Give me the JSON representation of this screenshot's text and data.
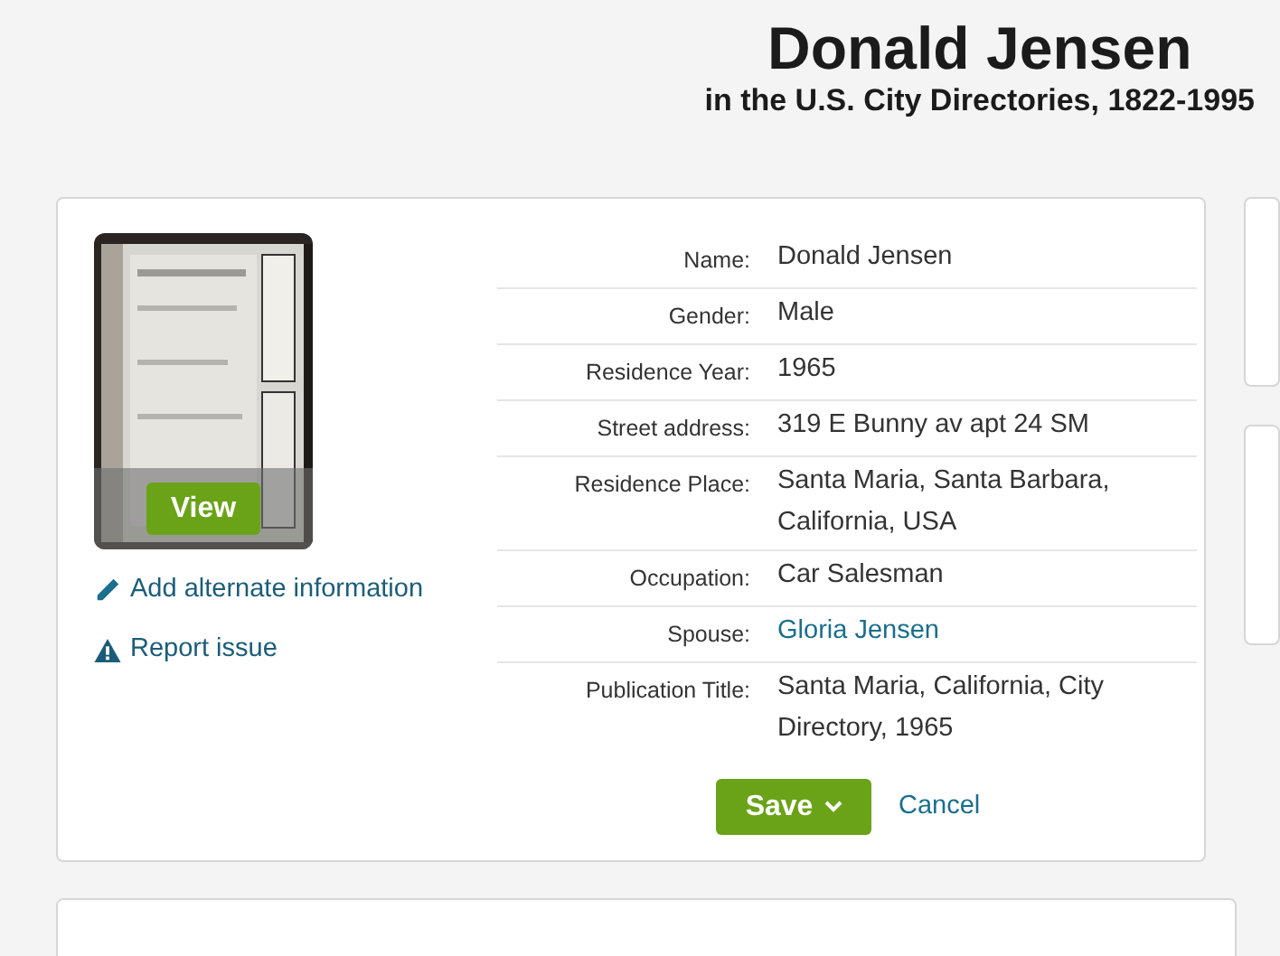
{
  "header": {
    "title": "Donald Jensen",
    "subtitle": "in the U.S. City Directories, 1822-1995"
  },
  "record": {
    "image": {
      "kind": "picture",
      "button": "View"
    },
    "actions": [
      {
        "kind": "edit",
        "label": "Add alternate information"
      },
      {
        "kind": "warning",
        "label": "Report issue"
      }
    ],
    "fields": [
      {
        "label": "Name:",
        "value": "Donald Jensen",
        "kind": "text"
      },
      {
        "label": "Gender:",
        "value": "Male",
        "kind": "text"
      },
      {
        "label": "Residence Year:",
        "value": "1965",
        "kind": "text"
      },
      {
        "label": "Street address:",
        "value": "319 E Bunny av apt 24 SM",
        "kind": "text"
      },
      {
        "label": "Residence Place:",
        "value": "Santa Maria, Santa Barbara, California, USA",
        "kind": "text"
      },
      {
        "label": "Occupation:",
        "value": "Car Salesman",
        "kind": "text"
      },
      {
        "label": "Spouse:",
        "value": "Gloria Jensen",
        "kind": "link"
      },
      {
        "label": "Publication Title:",
        "value": "Santa Maria, California, City Directory, 1965",
        "kind": "text"
      }
    ],
    "buttons": {
      "save": "Save",
      "cancel": "Cancel"
    }
  }
}
